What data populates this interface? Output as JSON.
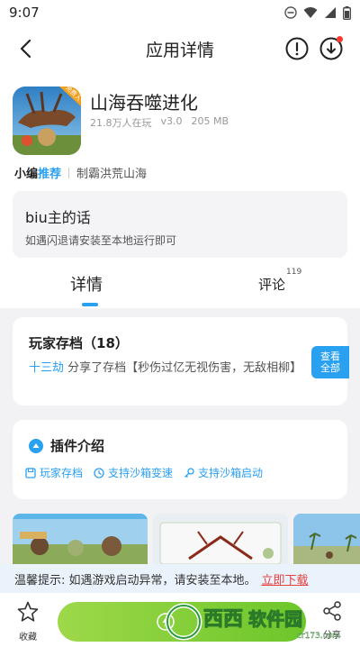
{
  "status_bar": {
    "time": "9:07"
  },
  "header": {
    "title": "应用详情"
  },
  "app": {
    "name": "山海吞噬进化",
    "players": "21.8万人在玩",
    "version": "v3.0",
    "size": "205 MB",
    "icon_badge": "免费入"
  },
  "editor": {
    "label_small": "小编",
    "label_rec": "推荐",
    "text": "制霸洪荒山海"
  },
  "biu": {
    "title": "biu主的话",
    "text": "如遇闪退请安装至本地运行即可"
  },
  "tabs": {
    "detail": "详情",
    "comment": "评论",
    "comment_count": "119"
  },
  "saves": {
    "title": "玩家存档（18）",
    "user": "十三劫",
    "desc": " 分享了存档【秒伤过亿无视伤害，无敌相柳】",
    "view_all_1": "查看",
    "view_all_2": "全部"
  },
  "plugins": {
    "title": "插件介绍",
    "items": [
      "玩家存档",
      "支持沙箱变速",
      "支持沙箱启动"
    ]
  },
  "notice": {
    "text": "温馨提示: 如遇游戏启动异常，请安装至本地。",
    "link": "立即下载"
  },
  "bottom": {
    "fav_label": "收藏",
    "share_label": "分享"
  },
  "watermark": {
    "text": "西西软件园",
    "url": "cr173.com"
  },
  "colors": {
    "accent": "#2aa0f0",
    "install_green": "#7ccd30",
    "link_red": "#e64040"
  }
}
